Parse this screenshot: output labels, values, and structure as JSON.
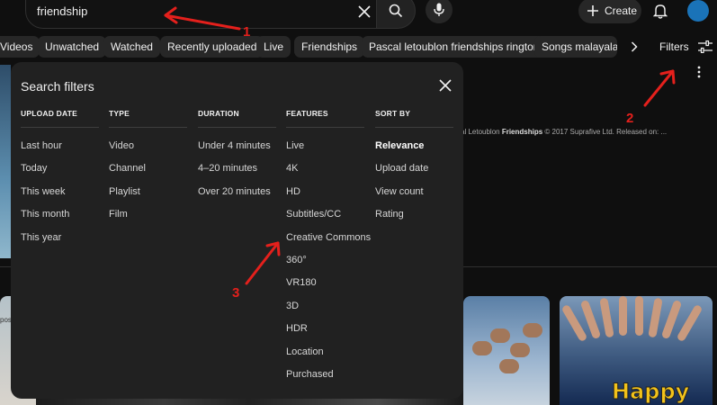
{
  "header": {
    "search_value": "friendship",
    "create_label": "Create",
    "icons": [
      "clear-icon",
      "search-icon",
      "mic-icon",
      "plus-icon",
      "bell-icon",
      "avatar"
    ]
  },
  "chips": [
    "Videos",
    "Unwatched",
    "Watched",
    "Recently uploaded",
    "Live",
    "Friendships",
    "Pascal letoublon friendships ringtone",
    "Songs malayalam"
  ],
  "filters_label": "Filters",
  "background": {
    "result_desc_prefix": "al Letoublon ",
    "result_desc_bold": "Friendships",
    "result_desc_suffix": " © 2017 Suprafive Ltd. Released on: ...",
    "thumb1_text": "pos",
    "thumb3_text": "Happy"
  },
  "dialog": {
    "title": "Search filters",
    "columns": [
      {
        "heading": "UPLOAD DATE",
        "options": [
          "Last hour",
          "Today",
          "This week",
          "This month",
          "This year"
        ]
      },
      {
        "heading": "TYPE",
        "options": [
          "Video",
          "Channel",
          "Playlist",
          "Film"
        ]
      },
      {
        "heading": "DURATION",
        "options": [
          "Under 4 minutes",
          "4–20 minutes",
          "Over 20 minutes"
        ]
      },
      {
        "heading": "FEATURES",
        "options": [
          "Live",
          "4K",
          "HD",
          "Subtitles/CC",
          "Creative Commons",
          "360°",
          "VR180",
          "3D",
          "HDR",
          "Location",
          "Purchased"
        ]
      },
      {
        "heading": "SORT BY",
        "options": [
          "Relevance",
          "Upload date",
          "View count",
          "Rating"
        ],
        "selected": "Relevance"
      }
    ]
  },
  "annotations": [
    "1",
    "2",
    "3"
  ],
  "colors": {
    "background": "#0f0f0f",
    "dialog": "#212121",
    "chip": "#272727",
    "annotation": "#e4201c"
  }
}
